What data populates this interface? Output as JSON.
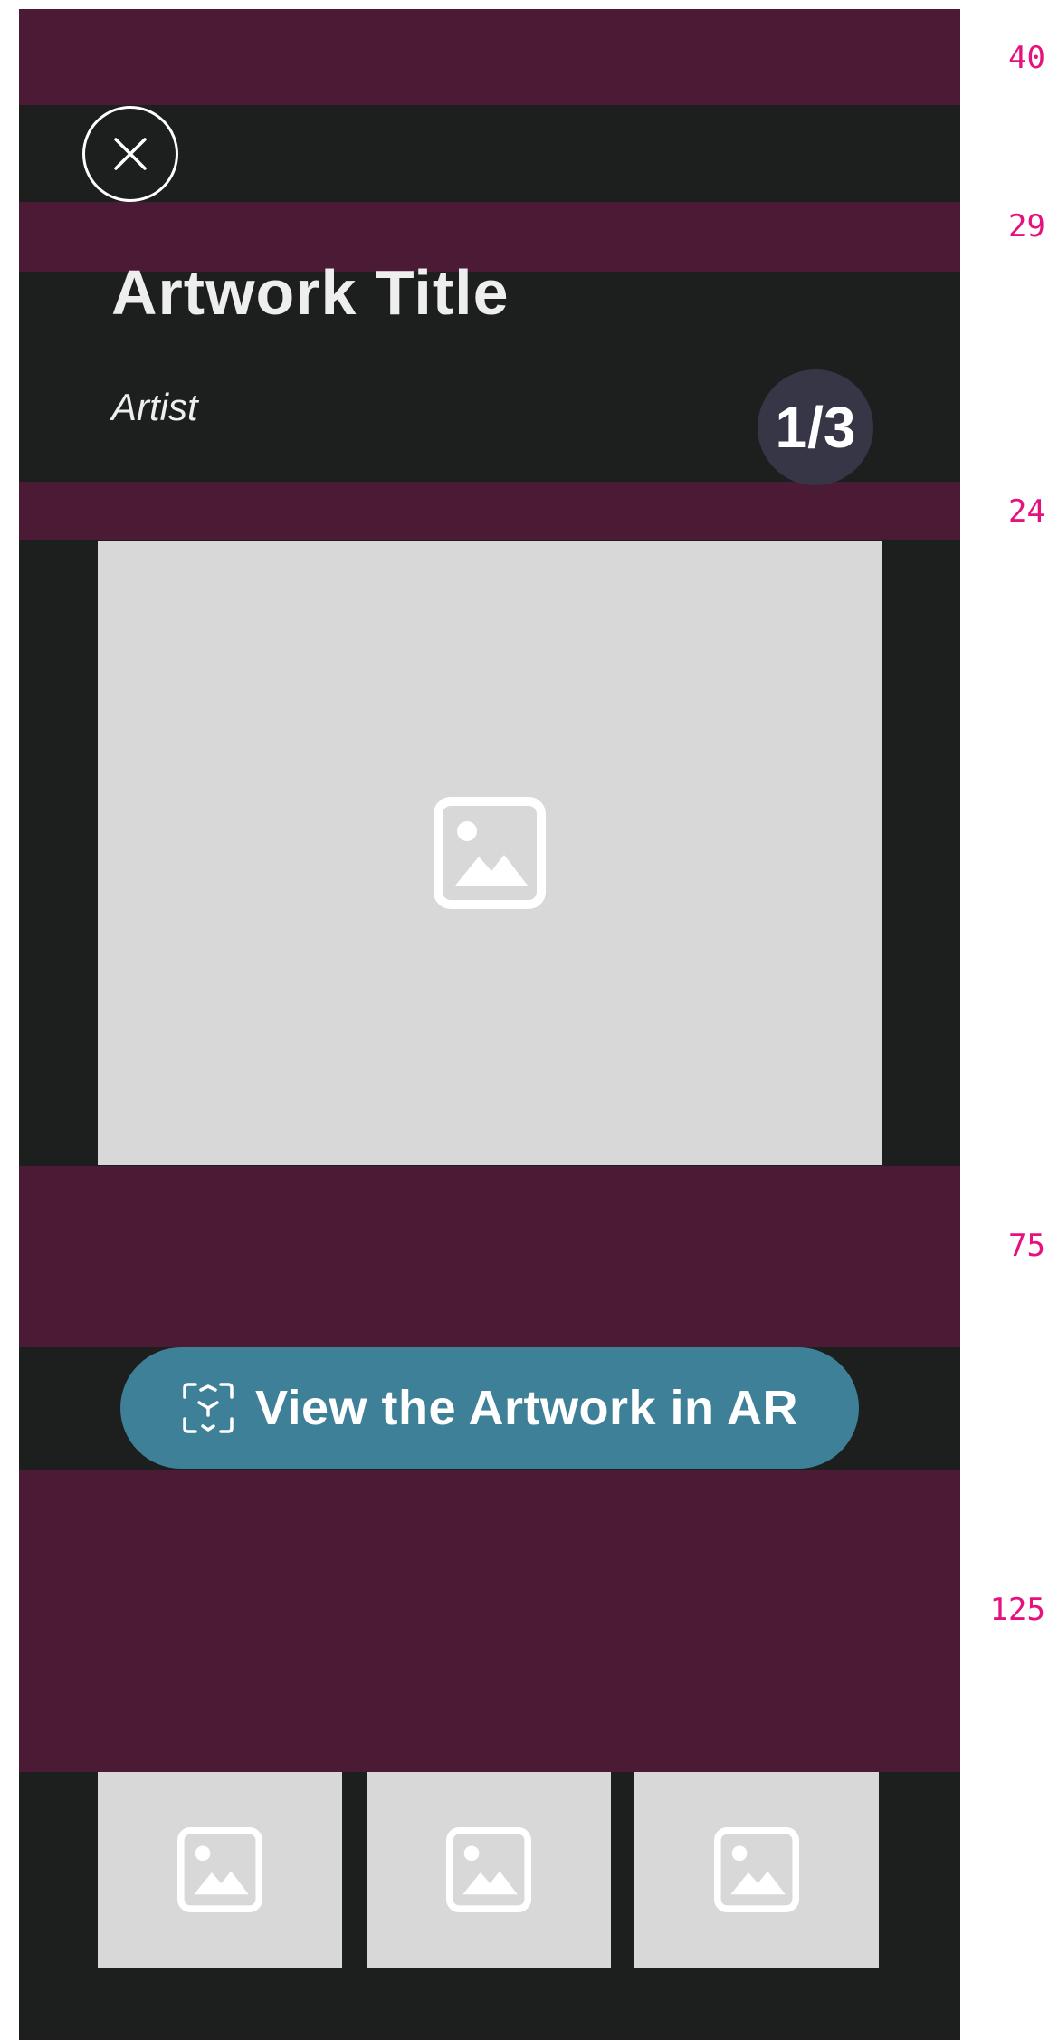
{
  "artwork": {
    "title": "Artwork Title",
    "artist": "Artist",
    "counter": "1/3"
  },
  "actions": {
    "close_icon": "close-icon",
    "ar_button_label": "View the Artwork in AR",
    "ar_icon": "ar-cube-icon"
  },
  "images": {
    "main_icon": "image-placeholder-icon",
    "thumbnails": [
      {
        "icon": "image-placeholder-icon"
      },
      {
        "icon": "image-placeholder-icon"
      },
      {
        "icon": "image-placeholder-icon"
      }
    ]
  },
  "spacing_labels": [
    "40",
    "29",
    "24",
    "75",
    "125"
  ],
  "colors": {
    "background": "#1d1e1e",
    "spacing_band": "#4b1b35",
    "spacing_label": "#e6117e",
    "ar_button": "#3e8097",
    "counter_badge": "#363647",
    "image_placeholder": "#d8d8d8"
  }
}
